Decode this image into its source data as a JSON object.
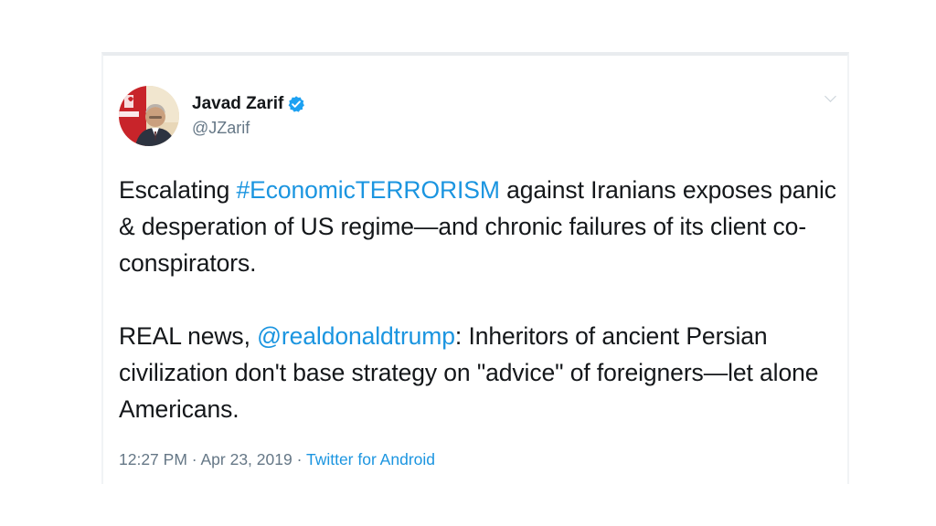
{
  "tweet": {
    "author": {
      "display_name": "Javad Zarif",
      "handle": "@JZarif",
      "verified": true,
      "verified_icon": "verified-badge-icon"
    },
    "paragraph1": {
      "part1": "Escalating ",
      "hashtag": "#EconomicTERRORISM",
      "part2": " against Iranians exposes panic & desperation of US regime—and chronic failures of its client co-conspirators."
    },
    "paragraph2": {
      "part1": "REAL news, ",
      "mention": "@realdonaldtrump",
      "part2": ": Inheritors of ancient Persian civilization don't base strategy on \"advice\" of foreigners—let alone Americans."
    },
    "time": "12:27 PM",
    "separator": " · ",
    "date": "Apr 23, 2019",
    "source": "Twitter for Android"
  },
  "colors": {
    "link": "#1b95e0",
    "text": "#14171a",
    "secondary": "#657786"
  }
}
